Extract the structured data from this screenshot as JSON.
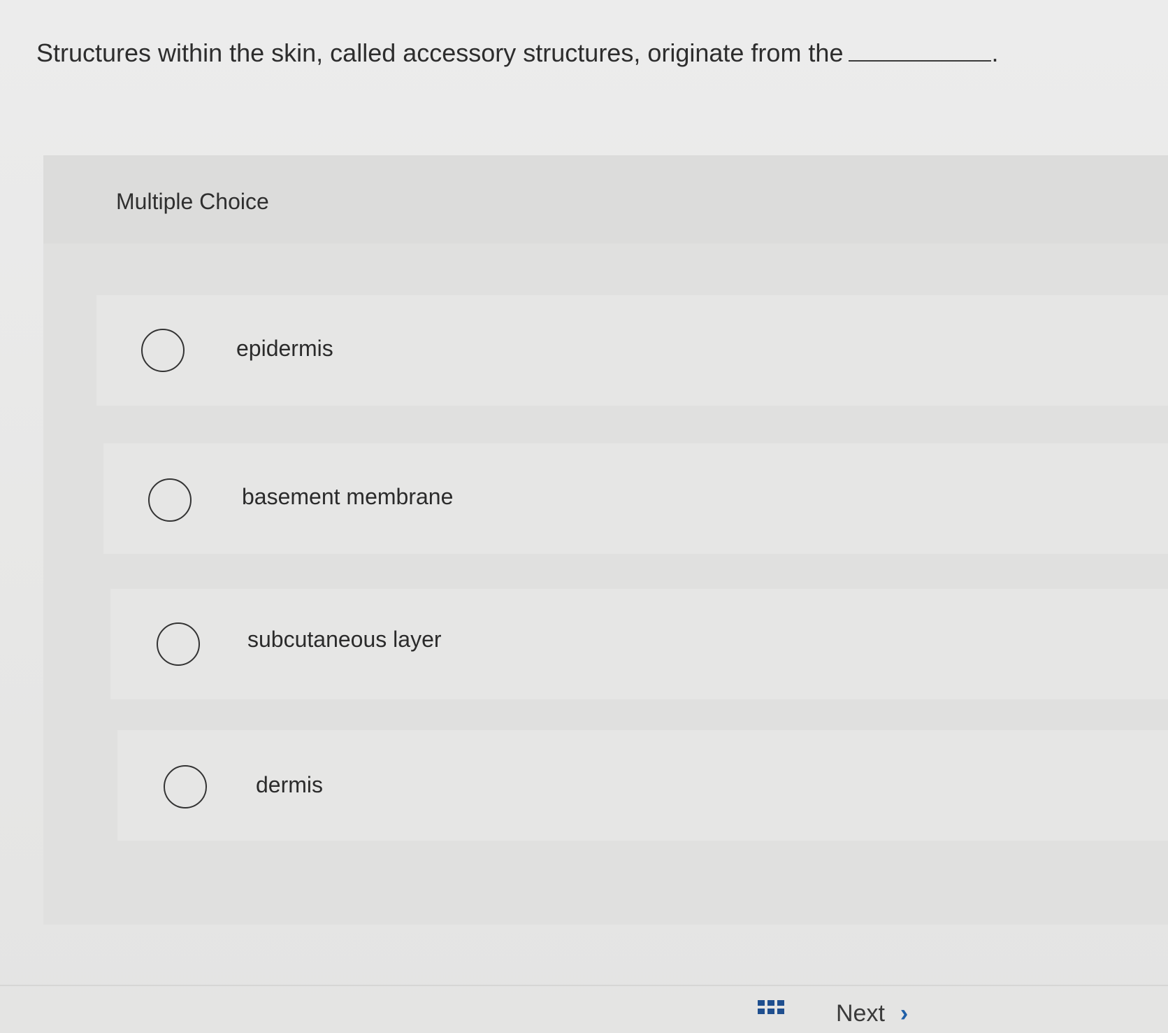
{
  "question": {
    "text": "Structures within the skin, called accessory structures, originate from the",
    "suffix": "."
  },
  "choice_block": {
    "heading": "Multiple Choice",
    "options": [
      {
        "label": "epidermis",
        "selected": false
      },
      {
        "label": "basement membrane",
        "selected": false
      },
      {
        "label": "subcutaneous layer",
        "selected": false
      },
      {
        "label": "dermis",
        "selected": false
      }
    ]
  },
  "footer": {
    "grid_icon": "grid-icon",
    "next_label": "Next",
    "next_icon": "chevron-right-icon"
  },
  "colors": {
    "accent": "#1f5fa8",
    "text": "#2b2b2b"
  }
}
